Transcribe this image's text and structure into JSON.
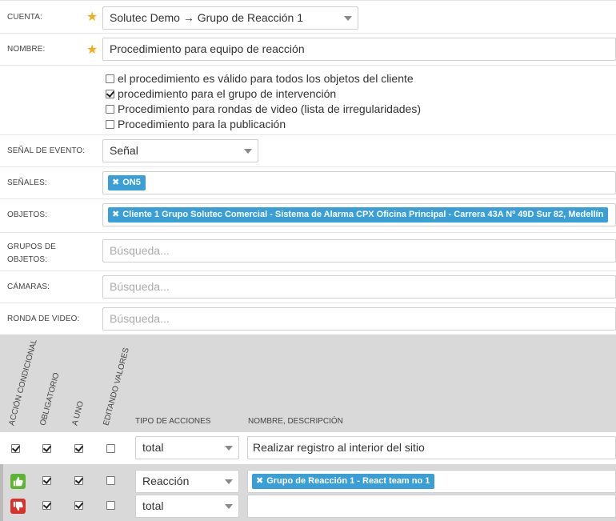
{
  "cuenta": {
    "label": "CUENTA:",
    "value": "Solutec Demo → Grupo de Reacción 1"
  },
  "nombre": {
    "label": "NOMBRE:",
    "value": "Procedimiento para equipo de reacción"
  },
  "checks": [
    {
      "label": "el procedimiento es válido para todos los objetos del cliente",
      "checked": false
    },
    {
      "label": "procedimiento para el grupo de intervención",
      "checked": true
    },
    {
      "label": "Procedimiento para rondas de video (lista de irregularidades)",
      "checked": false
    },
    {
      "label": "Procedimiento para la publicación",
      "checked": false
    }
  ],
  "senal_evento": {
    "label": "SEÑAL DE EVENTO:",
    "value": "Señal"
  },
  "senales": {
    "label": "SEÑALES:",
    "tag": "ON5"
  },
  "objetos": {
    "label": "OBJETOS:",
    "tag": "Cliente 1 Grupo Solutec Comercial - Sistema de Alarma CPX Oficina Principal - Carrera 43A Nº 49D Sur 82, Medellín"
  },
  "grupos": {
    "label_1": "GRUPOS DE",
    "label_2": "OBJETOS:",
    "placeholder": "Búsqueda..."
  },
  "camaras": {
    "label": "CÁMARAS:",
    "placeholder": "Búsqueda..."
  },
  "ronda": {
    "label": "RONDA DE VIDEO:",
    "placeholder": "Búsqueda..."
  },
  "table": {
    "headers": {
      "accion_condicional": "ACCIÓN CONDICIONAL",
      "obligatorio": "OBLIGATORIO",
      "a_uno": "A UNO",
      "editando": "EDITANDO VALORES",
      "tipo": "TIPO DE ACCIONES",
      "nombre": "NOMBRE, DESCRIPCIÓN"
    },
    "rows": [
      {
        "cond": true,
        "oblig": true,
        "uno": true,
        "edit": false,
        "tipo": "total",
        "desc": "Realizar registro al interior del sitio",
        "tag": ""
      },
      {
        "icon": "thumbs-up-icon",
        "oblig": true,
        "uno": true,
        "edit": false,
        "tipo": "Reacción",
        "desc": "",
        "tag": "Grupo de Reacción 1 - React team no 1"
      },
      {
        "icon": "thumbs-down-icon",
        "oblig": true,
        "uno": true,
        "edit": false,
        "tipo": "total",
        "desc": "",
        "tag": ""
      }
    ]
  },
  "colors": {
    "tag_blue": "#3a9fd6",
    "required_star": "#f0ad1c",
    "thumb_up": "#5cb531",
    "thumb_down": "#d9312b"
  }
}
